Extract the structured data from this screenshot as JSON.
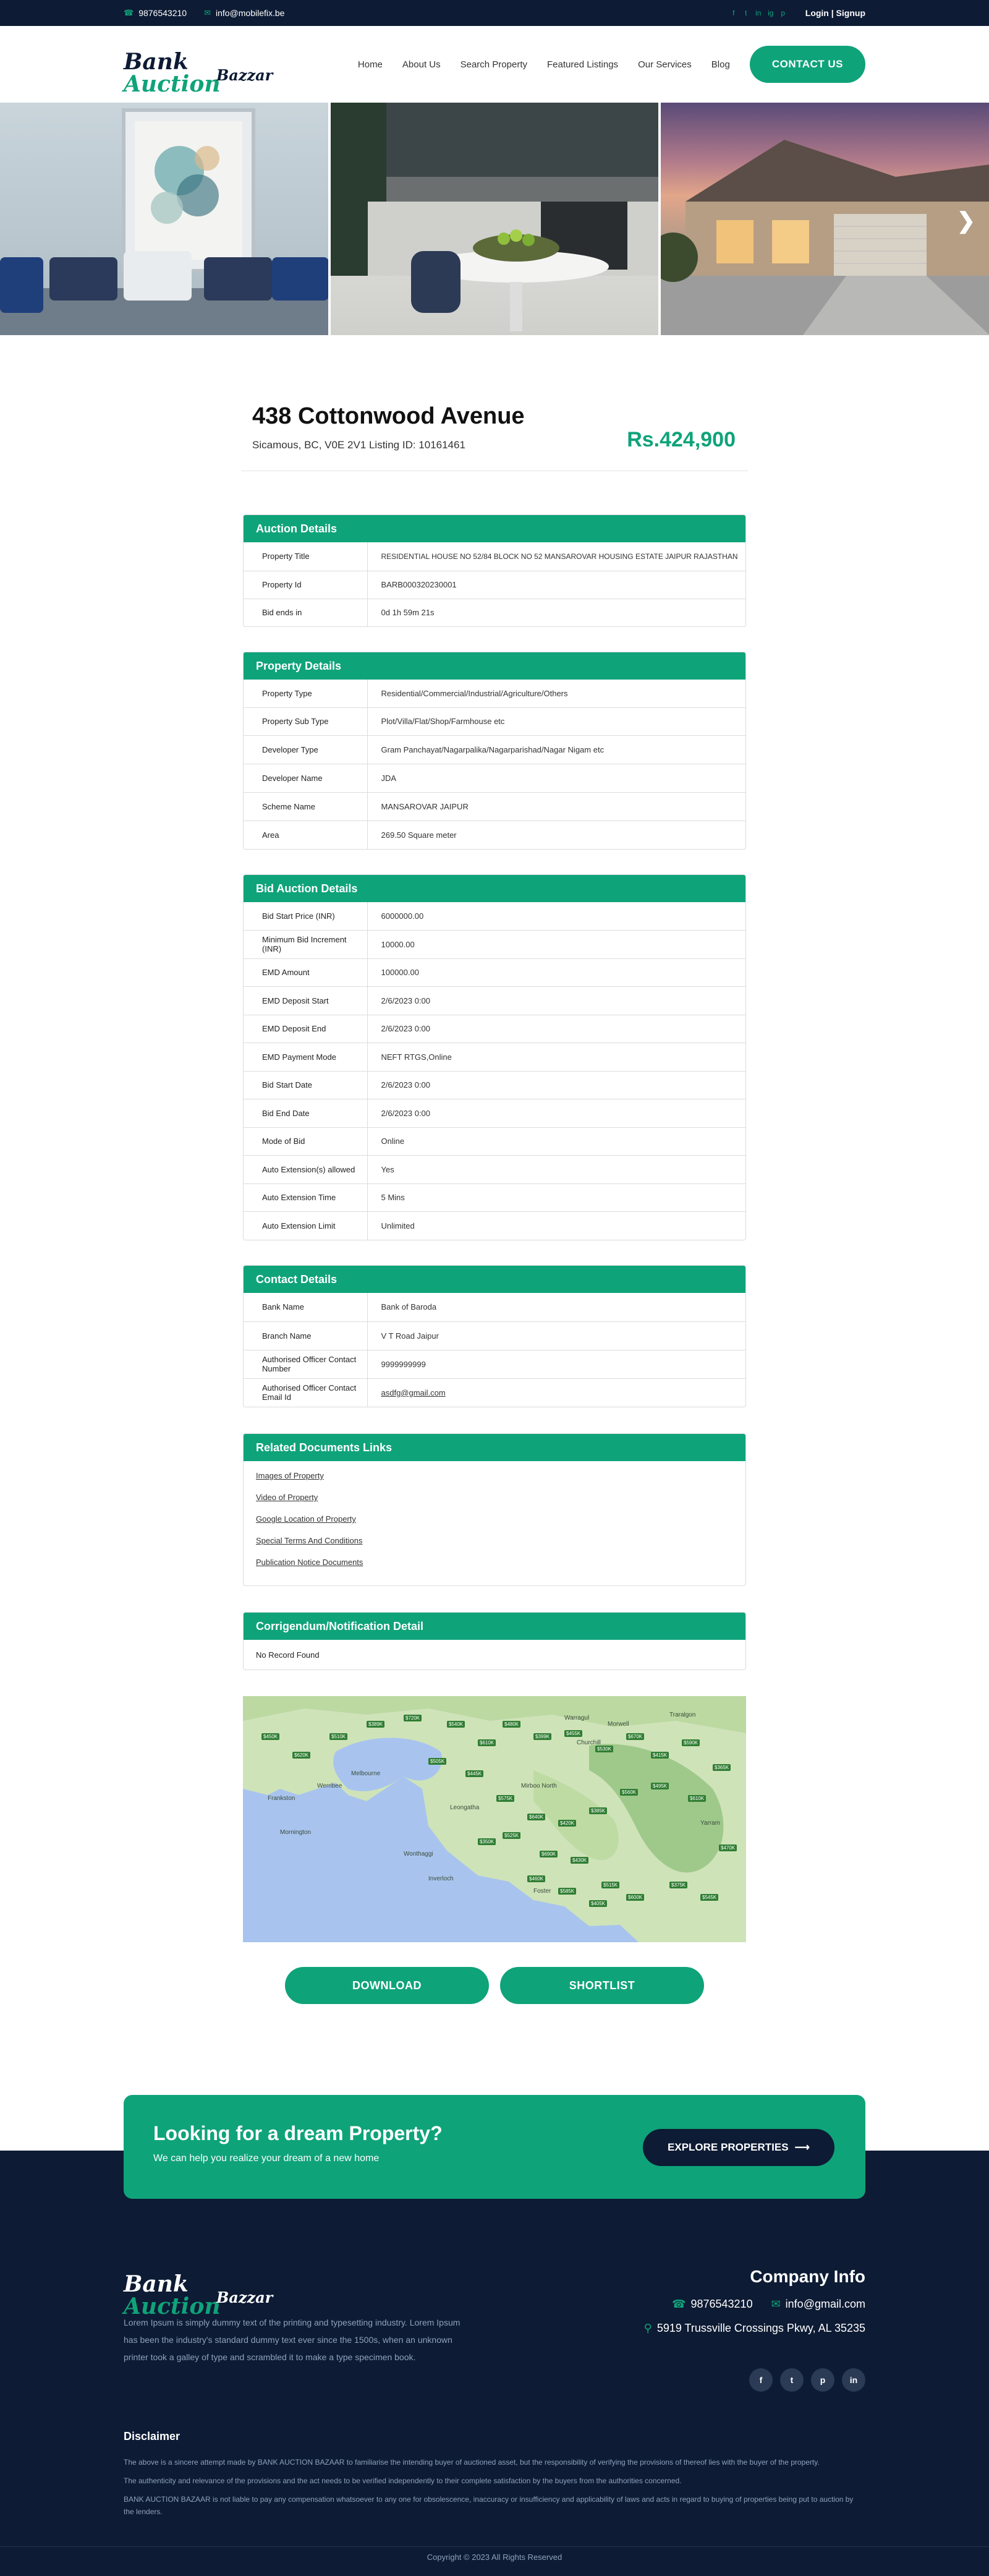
{
  "topbar": {
    "phone": "9876543210",
    "email": "info@mobilefix.be",
    "social": [
      "f",
      "t",
      "in",
      "ig",
      "p"
    ],
    "login": "Login | Signup"
  },
  "header": {
    "logo_line1_a": "Bank ",
    "logo_line1_b": "Auction",
    "logo_line2": "Bazzar",
    "nav": [
      "Home",
      "About Us",
      "Search Property",
      "Featured Listings",
      "Our Services",
      "Blog"
    ],
    "contact_button": "CONTACT US"
  },
  "property": {
    "title": "438 Cottonwood Avenue",
    "subtitle": "Sicamous, BC, V0E 2V1 Listing ID: 10161461",
    "price": "Rs.424,900"
  },
  "auction_details": {
    "heading": "Auction Details",
    "rows": [
      {
        "k": "Property Title",
        "v": "RESIDENTIAL HOUSE NO 52/84 BLOCK NO 52 MANSAROVAR HOUSING ESTATE JAIPUR RAJASTHAN"
      },
      {
        "k": "Property Id",
        "v": "BARB000320230001"
      },
      {
        "k": "Bid ends in",
        "v": "0d 1h 59m 21s"
      }
    ]
  },
  "property_details": {
    "heading": "Property Details",
    "rows": [
      {
        "k": "Property Type",
        "v": "Residential/Commercial/Industrial/Agriculture/Others"
      },
      {
        "k": "Property Sub Type",
        "v": "Plot/Villa/Flat/Shop/Farmhouse etc"
      },
      {
        "k": "Developer Type",
        "v": "Gram Panchayat/Nagarpalika/Nagarparishad/Nagar Nigam etc"
      },
      {
        "k": "Developer Name",
        "v": "JDA"
      },
      {
        "k": "Scheme Name",
        "v": "MANSAROVAR JAIPUR"
      },
      {
        "k": "Area",
        "v": "269.50 Square meter"
      }
    ]
  },
  "bid_details": {
    "heading": "Bid Auction Details",
    "rows": [
      {
        "k": "Bid Start Price (INR)",
        "v": "6000000.00"
      },
      {
        "k": "Minimum Bid Increment (INR)",
        "v": "10000.00"
      },
      {
        "k": "EMD Amount",
        "v": "100000.00"
      },
      {
        "k": "EMD Deposit Start",
        "v": "2/6/2023 0:00"
      },
      {
        "k": "EMD Deposit End",
        "v": "2/6/2023 0:00"
      },
      {
        "k": "EMD Payment Mode",
        "v": "NEFT RTGS,Online"
      },
      {
        "k": "Bid Start Date",
        "v": "2/6/2023 0:00"
      },
      {
        "k": "Bid End Date",
        "v": "2/6/2023 0:00"
      },
      {
        "k": "Mode of Bid",
        "v": "Online"
      },
      {
        "k": "Auto Extension(s) allowed",
        "v": "Yes"
      },
      {
        "k": "Auto Extension Time",
        "v": "5 Mins"
      },
      {
        "k": "Auto Extension Limit",
        "v": "Unlimited"
      }
    ]
  },
  "contact_details": {
    "heading": "Contact Details",
    "rows": [
      {
        "k": "Bank Name",
        "v": "Bank of Baroda"
      },
      {
        "k": "Branch Name",
        "v": "V T Road Jaipur"
      },
      {
        "k": "Authorised Officer Contact Number",
        "v": "9999999999"
      },
      {
        "k": "Authorised Officer Contact Email Id",
        "v": "asdfg@gmail.com"
      }
    ]
  },
  "documents": {
    "heading": "Related Documents Links",
    "links": [
      "Images of Property",
      "Video of Property",
      "Google Location of Property",
      "Special Terms And Conditions",
      "Publication Notice Documents"
    ]
  },
  "corrigendum": {
    "heading": "Corrigendum/Notification Detail",
    "text": "No Record Found"
  },
  "map": {
    "labels": [
      "Werribee",
      "Melbourne",
      "Mornington",
      "Frankston",
      "Warragul",
      "Morwell",
      "Traralgon",
      "Leongatha",
      "Wonthaggi",
      "Inverloch",
      "Yarram",
      "Foster",
      "Mirboo North",
      "Churchill"
    ],
    "price_tags": [
      "$450K",
      "$620K",
      "$510K",
      "$389K",
      "$720K",
      "$540K",
      "$610K",
      "$480K",
      "$399K",
      "$455K",
      "$530K",
      "$670K",
      "$415K",
      "$590K",
      "$365K",
      "$505K",
      "$445K",
      "$575K",
      "$640K",
      "$420K",
      "$385K",
      "$560K",
      "$495K",
      "$610K",
      "$470K",
      "$525K",
      "$350K",
      "$690K",
      "$430K",
      "$515K",
      "$600K",
      "$375K",
      "$545K",
      "$460K",
      "$585K",
      "$405K"
    ]
  },
  "actions": {
    "download": "DOWNLOAD",
    "shortlist": "SHORTLIST"
  },
  "cta": {
    "heading": "Looking for a dream Property?",
    "sub": "We can help you realize your dream of a new home",
    "button": "EXPLORE PROPERTIES"
  },
  "footer": {
    "about": "Lorem Ipsum is simply dummy text of the printing and typesetting industry. Lorem Ipsum has been the industry's standard dummy text ever since the 1500s, when an unknown printer took a galley of type and scrambled it to make a type specimen book.",
    "company_heading": "Company Info",
    "phone": "9876543210",
    "email": "info@gmail.com",
    "address": "5919 Trussville Crossings Pkwy, AL 35235",
    "social": [
      "f",
      "t",
      "p",
      "in"
    ],
    "disclaimer_heading": "Disclaimer",
    "disclaimer": [
      "The above is a sincere attempt made by BANK AUCTION BAZAAR to familiarise the intending buyer of auctioned asset, but the responsibility of verifying the provisions of thereof lies with the buyer of the property.",
      "The authenticity and relevance of the provisions and the act needs to be verified independently to their complete satisfaction by the buyers from the authorities concerned.",
      "BANK AUCTION BAZAAR is not liable to pay any compensation whatsoever to any one for obsolescence, inaccuracy or insufficiency and applicability of laws and acts in regard to buying of properties being put to auction by the lenders."
    ],
    "copyright": "Copyright © 2023 All Rights Reserved"
  },
  "colors": {
    "accent": "#0fa37a",
    "dark": "#0d1b34"
  }
}
